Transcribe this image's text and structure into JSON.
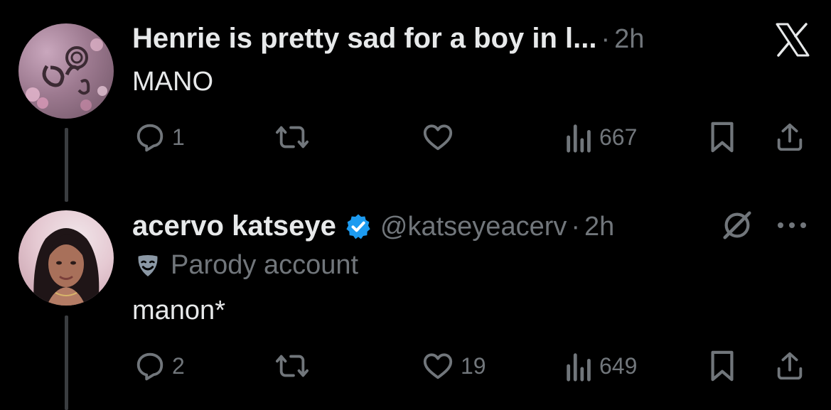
{
  "tweets": [
    {
      "display_name": "Henrie is pretty sad for a boy in l...",
      "separator": "·",
      "time": "2h",
      "text": "MANO",
      "replies": "1",
      "reposts": "",
      "likes": "",
      "views": "667",
      "avatar_icon": "pink-flower-avatar-icon"
    },
    {
      "display_name": "acervo katseye",
      "handle": "@katseyeacerv",
      "separator": "·",
      "time": "2h",
      "label": "Parody account",
      "text": "manon*",
      "replies": "2",
      "reposts": "",
      "likes": "19",
      "views": "649",
      "avatar_icon": "profile-photo-avatar-icon"
    }
  ],
  "colors": {
    "background": "#000000",
    "text": "#e7e9ea",
    "muted": "#71767b",
    "verified": "#1d9bf0",
    "thread_line": "#3a3d40"
  }
}
